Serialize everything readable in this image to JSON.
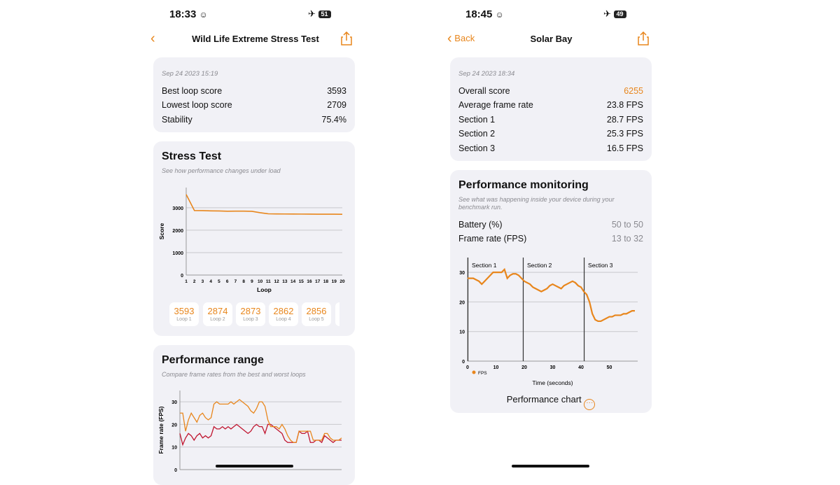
{
  "left": {
    "status": {
      "time": "18:33",
      "face": "☺",
      "airplane": "✈",
      "battery": "51"
    },
    "nav": {
      "back_icon": "chevron-left",
      "title": "Wild Life Extreme Stress Test",
      "share_icon": "share"
    },
    "summary": {
      "date": "Sep 24 2023 15:19",
      "rows": [
        {
          "label": "Best loop score",
          "value": "3593"
        },
        {
          "label": "Lowest loop score",
          "value": "2709"
        },
        {
          "label": "Stability",
          "value": "75.4%"
        }
      ]
    },
    "stress": {
      "title": "Stress Test",
      "subtitle": "See how performance changes under load",
      "loops": [
        {
          "value": "3593",
          "label": "Loop 1"
        },
        {
          "value": "2874",
          "label": "Loop 2"
        },
        {
          "value": "2873",
          "label": "Loop 3"
        },
        {
          "value": "2862",
          "label": "Loop 4"
        },
        {
          "value": "2856",
          "label": "Loop 5"
        }
      ]
    },
    "range": {
      "title": "Performance range",
      "subtitle": "Compare frame rates from the best and worst loops"
    }
  },
  "right": {
    "status": {
      "time": "18:45",
      "face": "☺",
      "airplane": "✈",
      "battery": "49"
    },
    "nav": {
      "back_label": "Back",
      "title": "Solar Bay",
      "share_icon": "share"
    },
    "summary": {
      "date": "Sep 24 2023 18:34",
      "rows": [
        {
          "label": "Overall score",
          "value": "6255"
        },
        {
          "label": "Average frame rate",
          "value": "23.8 FPS"
        },
        {
          "label": "Section 1",
          "value": "28.7 FPS"
        },
        {
          "label": "Section 2",
          "value": "25.3 FPS"
        },
        {
          "label": "Section 3",
          "value": "16.5 FPS"
        }
      ]
    },
    "monitoring": {
      "title": "Performance monitoring",
      "subtitle": "See what was happening inside your device during your benchmark run.",
      "rows": [
        {
          "label": "Battery (%)",
          "value": "50 to 50"
        },
        {
          "label": "Frame rate (FPS)",
          "value": "13 to 32"
        }
      ],
      "chart_button": "Performance chart"
    }
  },
  "colors": {
    "accent": "#e8861c",
    "worst": "#c0152f",
    "card": "#f1f1f6"
  },
  "chart_data": [
    {
      "type": "line",
      "id": "stress",
      "xlabel": "Loop",
      "ylabel": "Score",
      "ylim": [
        0,
        3900
      ],
      "yticks": [
        0,
        1000,
        2000,
        3000
      ],
      "x": [
        1,
        2,
        3,
        4,
        5,
        6,
        7,
        8,
        9,
        10,
        11,
        12,
        13,
        14,
        15,
        16,
        17,
        18,
        19,
        20
      ],
      "values": [
        3593,
        2874,
        2873,
        2862,
        2856,
        2845,
        2850,
        2848,
        2840,
        2780,
        2730,
        2725,
        2722,
        2720,
        2718,
        2716,
        2714,
        2712,
        2711,
        2709
      ],
      "grid": true
    },
    {
      "type": "line",
      "id": "range",
      "ylabel": "Frame rate (FPS)",
      "ylim": [
        0,
        35
      ],
      "yticks": [
        0,
        10,
        20,
        30
      ],
      "grid": true,
      "series": [
        {
          "role": "best",
          "values": [
            25,
            25,
            17,
            22,
            25,
            23,
            21,
            24,
            25,
            23,
            22,
            23,
            29,
            30,
            29,
            29,
            29,
            29,
            30,
            29,
            30,
            31,
            30,
            29,
            28,
            26,
            25,
            27,
            30,
            30,
            28,
            22,
            19,
            19,
            19,
            18,
            20,
            18,
            15,
            13,
            12,
            12,
            17,
            17,
            17,
            17,
            17,
            13,
            13,
            13,
            13,
            16,
            16,
            14,
            13,
            13,
            13,
            14
          ]
        },
        {
          "role": "worst",
          "values": [
            16,
            11,
            14,
            16,
            15,
            13,
            15,
            16,
            14,
            15,
            14,
            15,
            19,
            18,
            18,
            19,
            18,
            19,
            18,
            19,
            20,
            19,
            18,
            17,
            16,
            17,
            19,
            20,
            19,
            19,
            16,
            20,
            20,
            19,
            18,
            17,
            16,
            13,
            12,
            12,
            12,
            12,
            17,
            16,
            16,
            17,
            12,
            12,
            13,
            13,
            12,
            15,
            14,
            13,
            12,
            13,
            13,
            13
          ]
        }
      ]
    },
    {
      "type": "line",
      "id": "fps",
      "xlabel": "Time (seconds)",
      "xlim": [
        0,
        60
      ],
      "ylim": [
        0,
        35
      ],
      "xticks": [
        0,
        10,
        20,
        30,
        40,
        50
      ],
      "yticks": [
        0,
        10,
        20,
        30
      ],
      "grid": true,
      "legend": "bottom-left",
      "sections": [
        {
          "name": "Section 1",
          "start": 0
        },
        {
          "name": "Section 2",
          "start": 19.5
        },
        {
          "name": "Section 3",
          "start": 41
        }
      ],
      "series": [
        {
          "name": "FPS",
          "x_step": 1,
          "values": [
            28,
            28,
            28,
            27.5,
            27,
            26,
            27,
            28,
            29,
            30,
            30,
            30,
            30,
            31,
            28,
            29,
            29.5,
            29.5,
            29,
            28,
            27,
            26.5,
            26,
            25,
            24.5,
            24,
            23.5,
            24,
            24.5,
            25.5,
            26,
            25.5,
            25,
            24.5,
            25.5,
            26,
            26.5,
            27,
            26.5,
            25.5,
            25,
            23.5,
            22.5,
            20,
            16,
            14,
            13.5,
            13.5,
            14,
            14.5,
            15,
            15,
            15.5,
            15.5,
            15.5,
            16,
            16,
            16.5,
            17,
            17
          ]
        }
      ]
    }
  ]
}
